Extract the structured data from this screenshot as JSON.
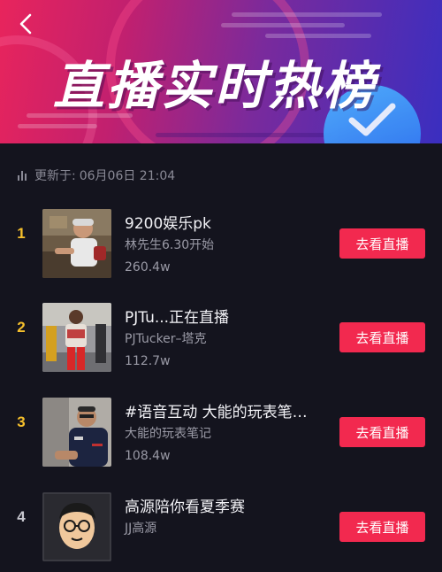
{
  "header": {
    "title": "直播实时热榜",
    "back_icon": "chevron-left-icon"
  },
  "update": {
    "label": "更新于:",
    "time": "06月06日 21:04",
    "icon": "bar-chart-icon"
  },
  "colors": {
    "accent": "#f2294f",
    "rank_top": "#f6c02c",
    "background": "#14141e"
  },
  "items": [
    {
      "rank": "1",
      "title": "9200娱乐pk",
      "host": "林先生6.30开始",
      "viewers": "260.4w",
      "button": "去看直播"
    },
    {
      "rank": "2",
      "title": "PJTu...正在直播",
      "host": "PJTucker–塔克",
      "viewers": "112.7w",
      "button": "去看直播"
    },
    {
      "rank": "3",
      "title": "#语音互动 大能的玩表笔…",
      "host": "大能的玩表笔记",
      "viewers": "108.4w",
      "button": "去看直播"
    },
    {
      "rank": "4",
      "title": "高源陪你看夏季赛",
      "host": "JJ高源",
      "viewers": "",
      "button": "去看直播"
    }
  ]
}
